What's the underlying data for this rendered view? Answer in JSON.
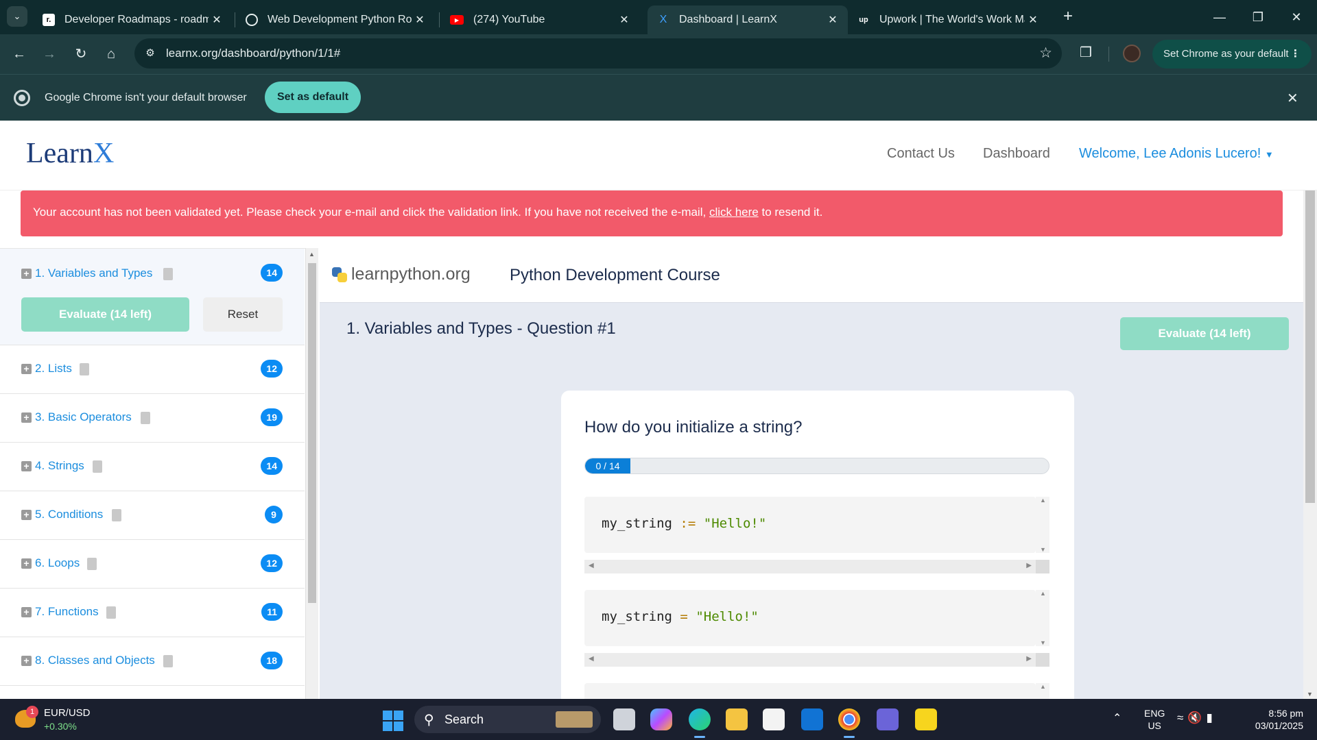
{
  "browser": {
    "tabs": [
      {
        "title": "Developer Roadmaps - roadmap.sh",
        "favicon": "roadmap-favicon"
      },
      {
        "title": "Web Development Python Roadmap",
        "favicon": "openai-favicon"
      },
      {
        "title": "(274) YouTube",
        "favicon": "youtube-favicon"
      },
      {
        "title": "Dashboard | LearnX",
        "favicon": "learnx-favicon",
        "active": true
      },
      {
        "title": "Upwork | The World's Work Marketplace",
        "favicon": "upwork-favicon"
      }
    ],
    "url": "learnx.org/dashboard/python/1/1#",
    "set_default_pill": "Set Chrome as your default"
  },
  "infobar": {
    "message": "Google Chrome isn't your default browser",
    "button": "Set as default"
  },
  "site": {
    "logo_main": "Learn",
    "logo_accent": "X",
    "nav": {
      "contact": "Contact Us",
      "dashboard": "Dashboard",
      "welcome": "Welcome, Lee Adonis Lucero!"
    },
    "alert": {
      "before": "Your account has not been validated yet. Please check your e-mail and click the validation link. If you have not received the e-mail, ",
      "link": "click here",
      "after": " to resend it."
    }
  },
  "sidebar": {
    "lessons": [
      {
        "label": "1. Variables and Types",
        "count": "14"
      },
      {
        "label": "2. Lists",
        "count": "12"
      },
      {
        "label": "3. Basic Operators",
        "count": "19"
      },
      {
        "label": "4. Strings",
        "count": "14"
      },
      {
        "label": "5. Conditions",
        "count": "9"
      },
      {
        "label": "6. Loops",
        "count": "12"
      },
      {
        "label": "7. Functions",
        "count": "11"
      },
      {
        "label": "8. Classes and Objects",
        "count": "18"
      }
    ],
    "evaluate_label": "Evaluate (14 left)",
    "reset_label": "Reset"
  },
  "main": {
    "brand": "learnpython.org",
    "course_title": "Python Development Course",
    "question_heading": "1. Variables and Types - Question #1",
    "evaluate_label": "Evaluate (14 left)",
    "question": "How do you initialize a string?",
    "progress_text": "0 / 14",
    "progress_value": 0,
    "progress_total": 14,
    "options": [
      {
        "var": "my_string",
        "op": ":=",
        "str": "\"Hello!\""
      },
      {
        "var": "my_string",
        "op": "=",
        "str": "\"Hello!\""
      }
    ]
  },
  "taskbar": {
    "ticker_pair": "EUR/USD",
    "ticker_change": "+0.30%",
    "notification_count": "1",
    "search_label": "Search",
    "lang_top": "ENG",
    "lang_bottom": "US",
    "time": "8:56 pm",
    "date": "03/01/2025"
  },
  "colors": {
    "chrome_dark": "#0f2b2e",
    "chrome_toolbar": "#1f3d40",
    "accent_teal": "#5fd0c2",
    "alert_red": "#f25a6a",
    "link_blue": "#1b8dde",
    "badge_blue": "#0b8cf4",
    "evaluate_green": "#8fdcc5"
  }
}
